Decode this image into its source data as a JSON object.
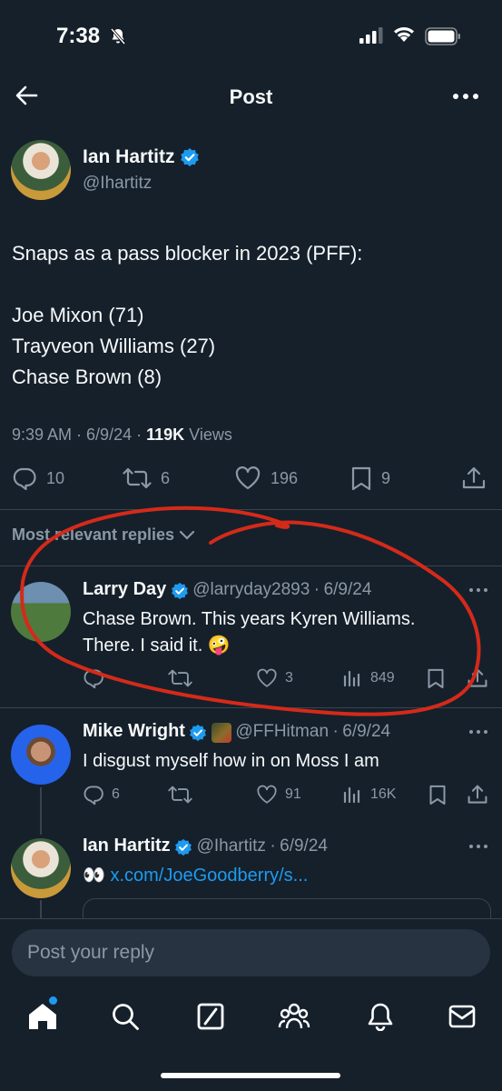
{
  "status_bar": {
    "time": "7:38",
    "icons": [
      "bell-slash-icon",
      "signal-icon",
      "wifi-icon",
      "battery-icon"
    ]
  },
  "header": {
    "title": "Post",
    "back_icon": "arrow-left-icon",
    "more_icon": "more-horizontal-icon"
  },
  "post": {
    "author_name": "Ian Hartitz",
    "author_handle": "@Ihartitz",
    "lines": [
      "Snaps as a pass blocker in 2023 (PFF):",
      "",
      "Joe Mixon (71)",
      "Trayveon Williams (27)",
      "Chase Brown (8)"
    ],
    "time": "9:39 AM",
    "date": "6/9/24",
    "views_count": "119K",
    "views_label": "Views",
    "replies": "10",
    "reposts": "6",
    "likes": "196",
    "bookmarks": "9"
  },
  "replies_sort": "Most relevant replies",
  "replies": [
    {
      "name": "Larry Day",
      "handle": "@larryday2893",
      "date": "6/9/24",
      "text_line1": "Chase Brown. This years Kyren Williams.",
      "text_line2": "There. I said it. 🤪",
      "replies": "",
      "reposts": "",
      "likes": "3",
      "views": "849"
    },
    {
      "name": "Mike Wright",
      "handle": "@FFHitman",
      "date": "6/9/24",
      "text": "I disgust myself how in on Moss I am",
      "replies": "6",
      "reposts": "",
      "likes": "91",
      "views": "16K"
    },
    {
      "name": "Ian Hartitz",
      "handle": "@Ihartitz",
      "date": "6/9/24",
      "emoji": "👀",
      "link": "x.com/JoeGoodberry/s..."
    }
  ],
  "reply_box": {
    "placeholder": "Post your reply"
  },
  "bottom_nav": [
    "home-icon",
    "search-icon",
    "grok-icon",
    "communities-icon",
    "notifications-icon",
    "messages-icon"
  ],
  "colors": {
    "background": "#15202b",
    "accent": "#1d9bf0",
    "muted": "#8b98a5",
    "annotation": "#d42a1a"
  }
}
